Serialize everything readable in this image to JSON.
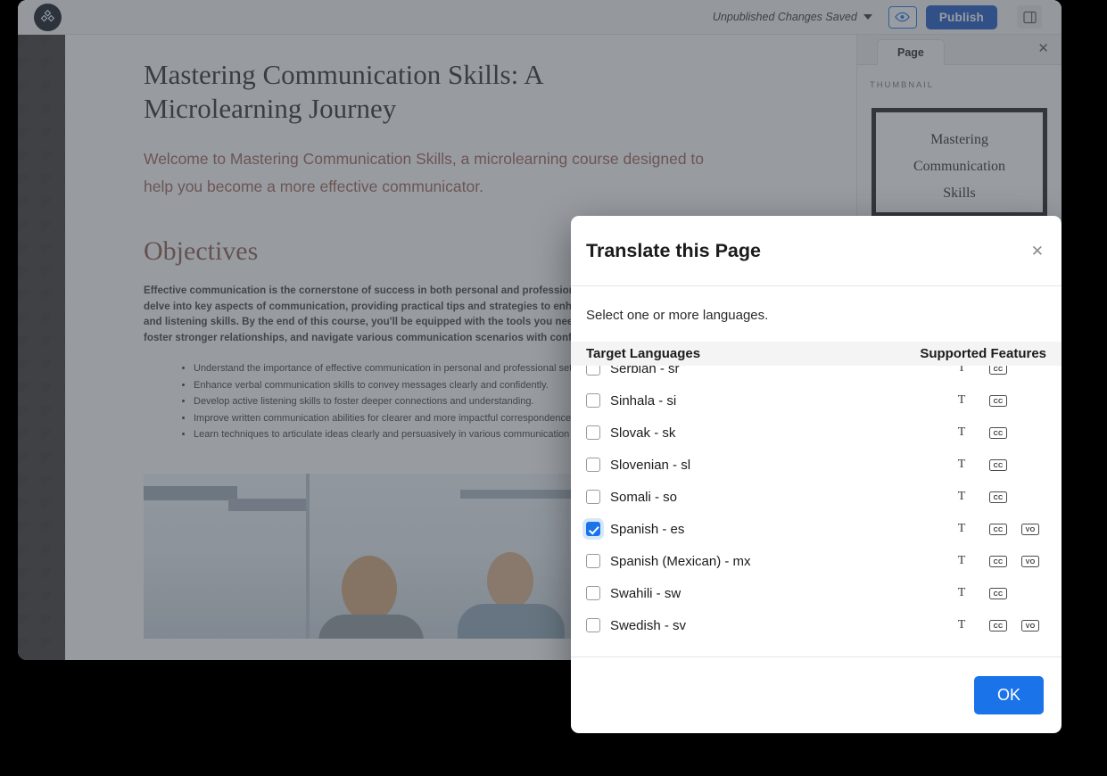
{
  "app": {
    "logo_icon": "diamond-cluster-logo",
    "toolbar": {
      "save_status": "Unpublished Changes Saved",
      "caret_icon": "chevron-down-icon",
      "preview_icon": "eye-icon",
      "publish_label": "Publish",
      "panel_toggle_icon": "side-panel-icon"
    }
  },
  "document": {
    "title": "Mastering Communication Skills: A Microlearning Journey",
    "subtitle": "Welcome to Mastering Communication Skills, a microlearning course designed to help you become a more effective communicator.",
    "section_heading": "Objectives",
    "paragraph": "Effective communication is the cornerstone of success in both personal and professional life. In this course, we'll delve into key aspects of communication, providing practical tips and strategies to enhance your verbal, written, and listening skills. By the end of this course, you'll be equipped with the tools you need to articulate ideas clearly, foster stronger relationships, and navigate various communication scenarios with confidence.",
    "bullets": [
      "Understand the importance of effective communication in personal and professional settings.",
      "Enhance verbal communication skills to convey messages clearly and confidently.",
      "Develop active listening skills to foster deeper connections and understanding.",
      "Improve written communication abilities for clearer and more impactful correspondence.",
      "Learn techniques to articulate ideas clearly and persuasively in various communication settings."
    ],
    "photo_alt": "three business colleagues talking in an office"
  },
  "side_panel": {
    "tab_label": "Page",
    "close_icon": "close-icon",
    "thumbnail_label": "THUMBNAIL",
    "thumbnail_lines": [
      "Mastering",
      "Communication",
      "Skills"
    ]
  },
  "modal": {
    "title": "Translate this Page",
    "close_icon": "close-icon",
    "instruction": "Select one or more languages.",
    "columns": {
      "languages": "Target Languages",
      "features": "Supported Features"
    },
    "feature_labels": {
      "text": "T",
      "captions": "CC",
      "voiceover": "VO"
    },
    "languages": [
      {
        "name": "Serbian - sr",
        "checked": false,
        "features": [
          "T",
          "CC"
        ]
      },
      {
        "name": "Sinhala - si",
        "checked": false,
        "features": [
          "T",
          "CC"
        ]
      },
      {
        "name": "Slovak - sk",
        "checked": false,
        "features": [
          "T",
          "CC"
        ]
      },
      {
        "name": "Slovenian - sl",
        "checked": false,
        "features": [
          "T",
          "CC"
        ]
      },
      {
        "name": "Somali - so",
        "checked": false,
        "features": [
          "T",
          "CC"
        ]
      },
      {
        "name": "Spanish - es",
        "checked": true,
        "features": [
          "T",
          "CC",
          "VO"
        ]
      },
      {
        "name": "Spanish (Mexican) - mx",
        "checked": false,
        "features": [
          "T",
          "CC",
          "VO"
        ]
      },
      {
        "name": "Swahili - sw",
        "checked": false,
        "features": [
          "T",
          "CC"
        ]
      },
      {
        "name": "Swedish - sv",
        "checked": false,
        "features": [
          "T",
          "CC",
          "VO"
        ]
      }
    ],
    "ok_label": "OK"
  },
  "colors": {
    "accent_blue": "#1a73e8",
    "publish_blue": "#1a56c4",
    "heading_brown": "#8a5a4c",
    "subtitle_brown": "#9b5f53"
  }
}
